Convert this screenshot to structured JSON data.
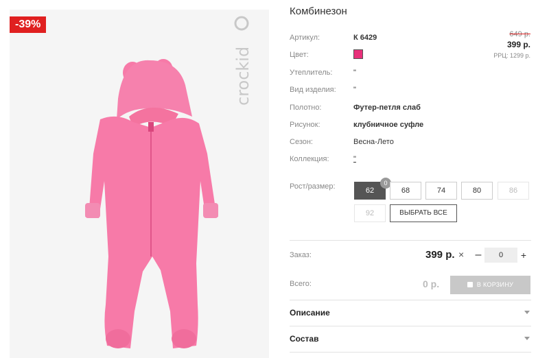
{
  "badge": {
    "discount": "-39%"
  },
  "product": {
    "title": "Комбинезон"
  },
  "specs": {
    "article_label": "Артикул:",
    "article_value": "К 6429",
    "color_label": "Цвет:",
    "color_swatch": "#e8307a",
    "insulation_label": "Утеплитель:",
    "insulation_value": "\"",
    "type_label": "Вид изделия:",
    "type_value": "\"",
    "fabric_label": "Полотно:",
    "fabric_value": "Футер-петля слаб",
    "pattern_label": "Рисунок:",
    "pattern_value": "клубничное суфле",
    "season_label": "Сезон:",
    "season_value": "Весна-Лето",
    "collection_label": "Коллекция:",
    "collection_value": "\""
  },
  "price": {
    "old": "649 р.",
    "current": "399 р.",
    "rrp": "РРЦ: 1299 р."
  },
  "sizes": {
    "label": "Рост/размер:",
    "selected_count": "0",
    "items": [
      {
        "value": "62",
        "state": "selected"
      },
      {
        "value": "68",
        "state": "available"
      },
      {
        "value": "74",
        "state": "available"
      },
      {
        "value": "80",
        "state": "available"
      },
      {
        "value": "86",
        "state": "disabled"
      },
      {
        "value": "92",
        "state": "disabled"
      }
    ],
    "select_all_label": "ВЫБРАТЬ ВСЕ"
  },
  "order": {
    "label": "Заказ:",
    "price": "399 р.",
    "times_symbol": "×",
    "minus": "–",
    "quantity": "0",
    "plus": "+"
  },
  "total": {
    "label": "Всего:",
    "value": "0 р.",
    "cart_button": "В КОРЗИНУ"
  },
  "accordions": {
    "description": "Описание",
    "composition": "Состав"
  },
  "colors": {
    "accent_red": "#e02020",
    "product_pink": "#f77aa8",
    "selected_size": "#555555"
  }
}
